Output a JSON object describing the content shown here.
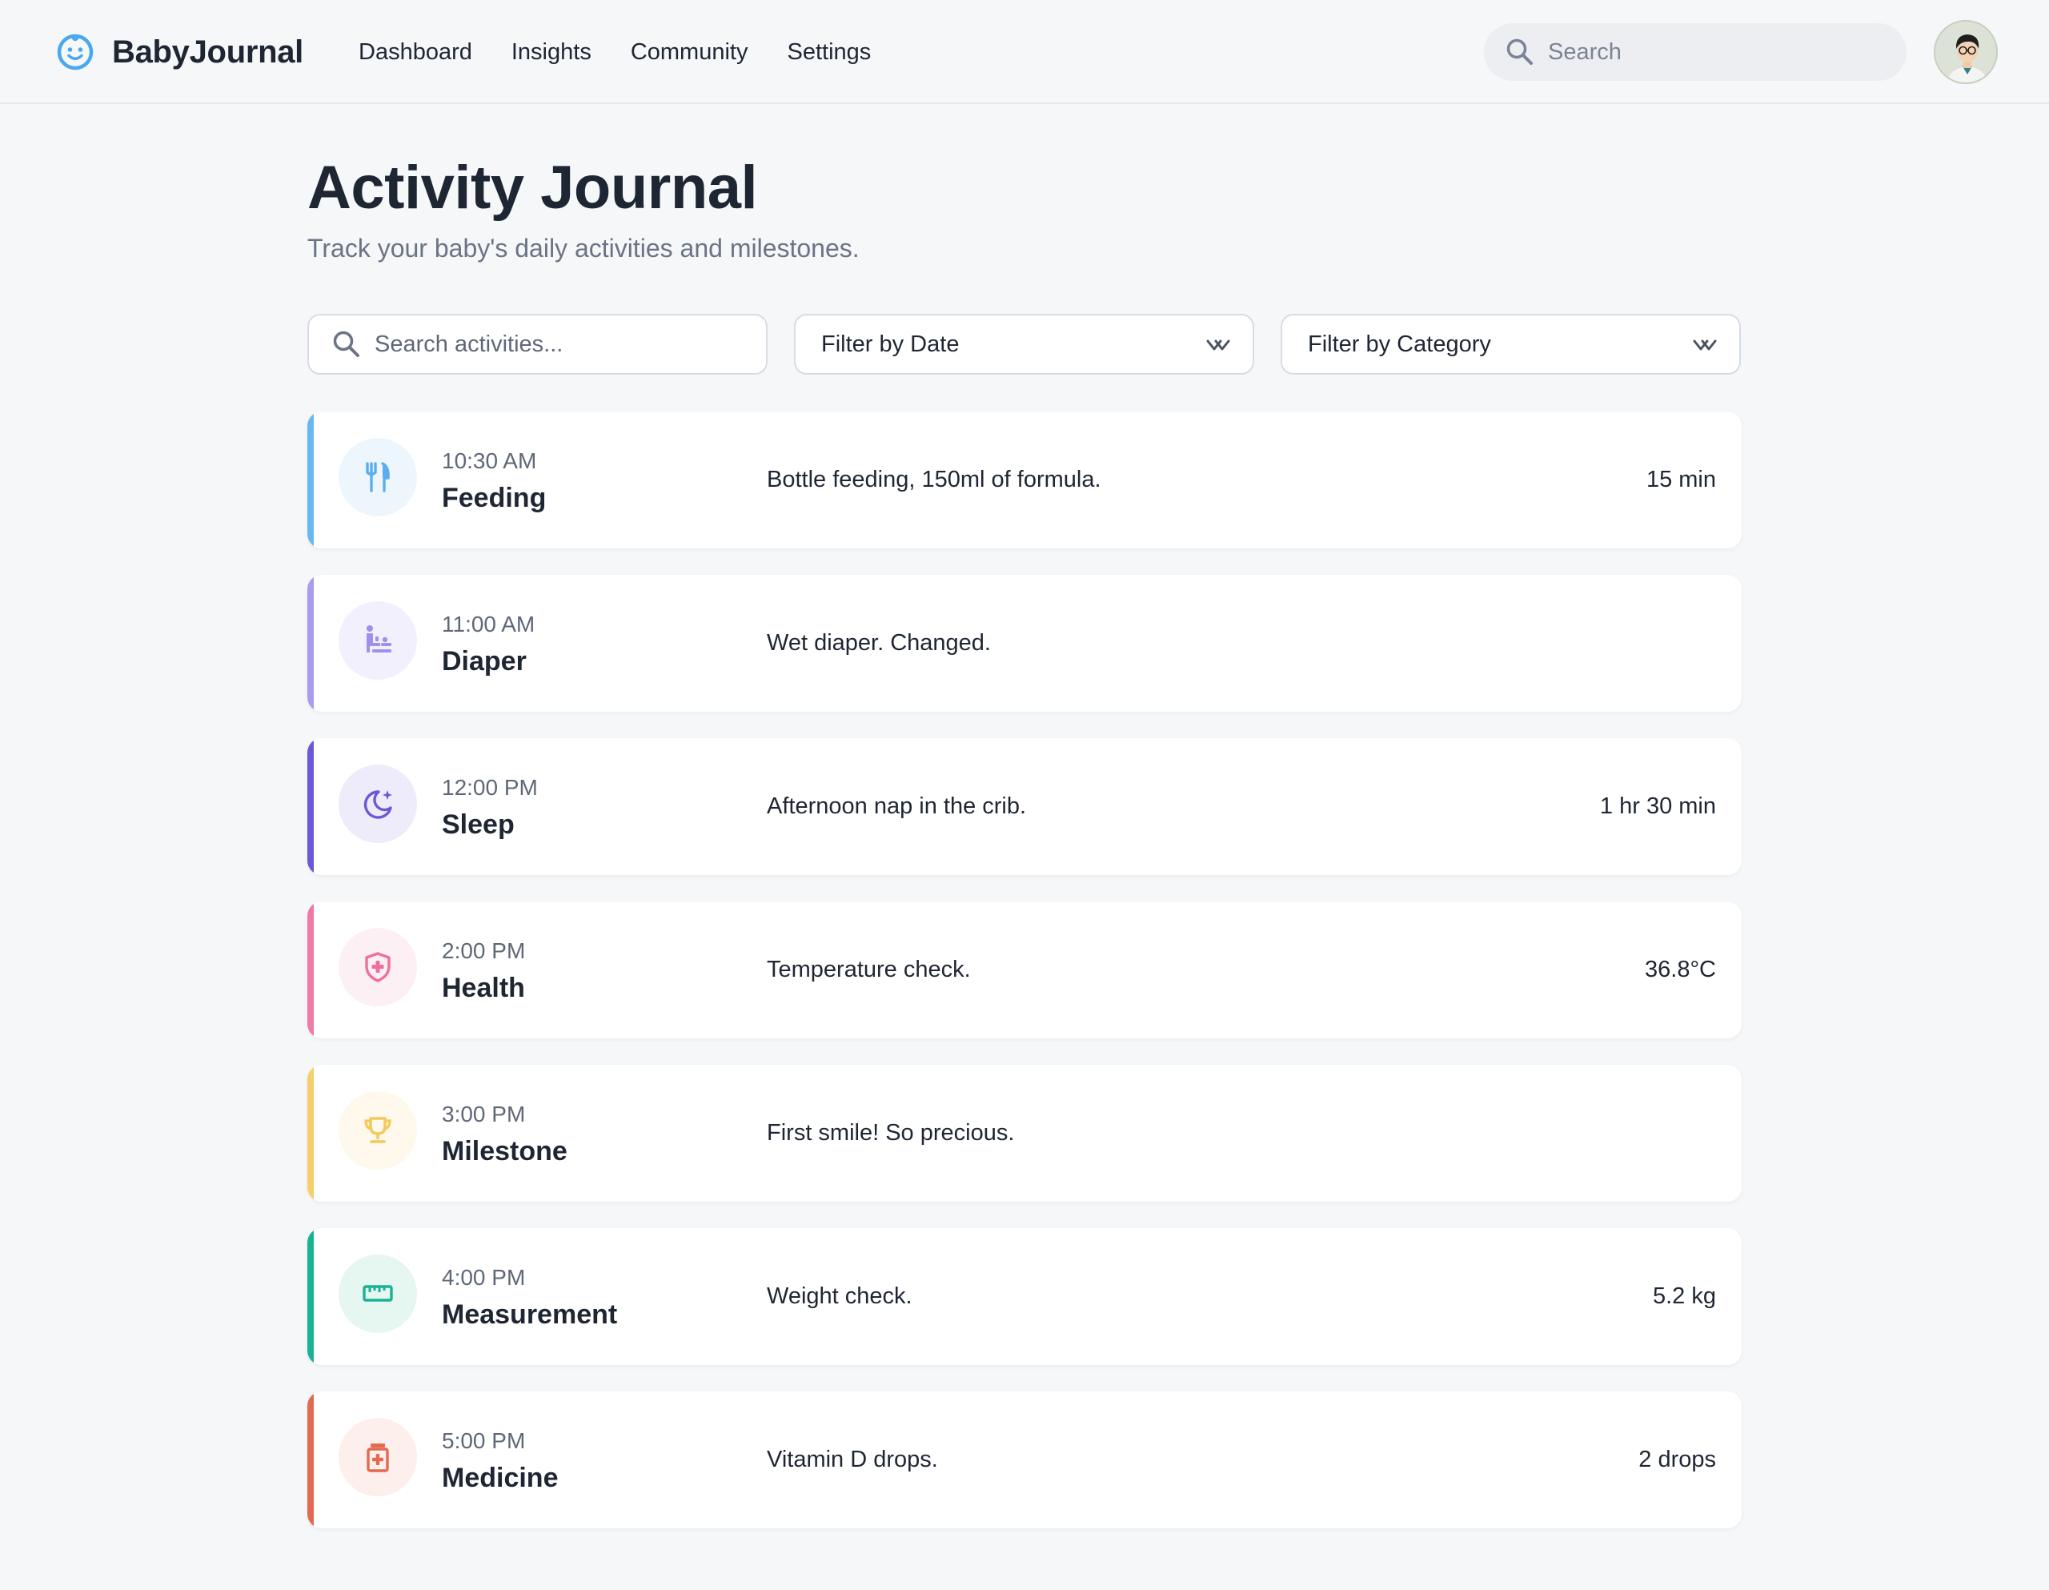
{
  "app": {
    "name": "BabyJournal",
    "brand_color": "#4aa8f0"
  },
  "nav": {
    "links": [
      "Dashboard",
      "Insights",
      "Community",
      "Settings"
    ]
  },
  "header_search": {
    "placeholder": "Search"
  },
  "page": {
    "title": "Activity Journal",
    "subtitle": "Track your baby's daily activities and milestones."
  },
  "filters": {
    "search_placeholder": "Search activities...",
    "date_label": "Filter by Date",
    "category_label": "Filter by Category"
  },
  "activities": [
    {
      "time": "10:30 AM",
      "category": "Feeding",
      "description": "Bottle feeding, 150ml of formula.",
      "value": "15 min",
      "icon": "fork-knife-icon",
      "accent": "#6bb8f0",
      "icon_bg": "#eef6fd",
      "icon_color": "#5aaeee"
    },
    {
      "time": "11:00 AM",
      "category": "Diaper",
      "description": "Wet diaper. Changed.",
      "value": "",
      "icon": "baby-changing-icon",
      "accent": "#a99bee",
      "icon_bg": "#f2f0fd",
      "icon_color": "#a18fec"
    },
    {
      "time": "12:00 PM",
      "category": "Sleep",
      "description": "Afternoon nap in the crib.",
      "value": "1 hr 30 min",
      "icon": "moon-star-icon",
      "accent": "#6b58d8",
      "icon_bg": "#eeecfa",
      "icon_color": "#6b58d8"
    },
    {
      "time": "2:00 PM",
      "category": "Health",
      "description": "Temperature check.",
      "value": "36.8°C",
      "icon": "shield-plus-icon",
      "accent": "#f07aa6",
      "icon_bg": "#fdf0f4",
      "icon_color": "#ee6f9e"
    },
    {
      "time": "3:00 PM",
      "category": "Milestone",
      "description": "First smile! So precious.",
      "value": "",
      "icon": "trophy-icon",
      "accent": "#f7cf6a",
      "icon_bg": "#fef9ec",
      "icon_color": "#f4c95a"
    },
    {
      "time": "4:00 PM",
      "category": "Measurement",
      "description": "Weight check.",
      "value": "5.2 kg",
      "icon": "ruler-icon",
      "accent": "#17b393",
      "icon_bg": "#e6f6f1",
      "icon_color": "#17b393"
    },
    {
      "time": "5:00 PM",
      "category": "Medicine",
      "description": "Vitamin D drops.",
      "value": "2 drops",
      "icon": "medicine-bottle-icon",
      "accent": "#e26a50",
      "icon_bg": "#fcefec",
      "icon_color": "#e26a50"
    }
  ]
}
